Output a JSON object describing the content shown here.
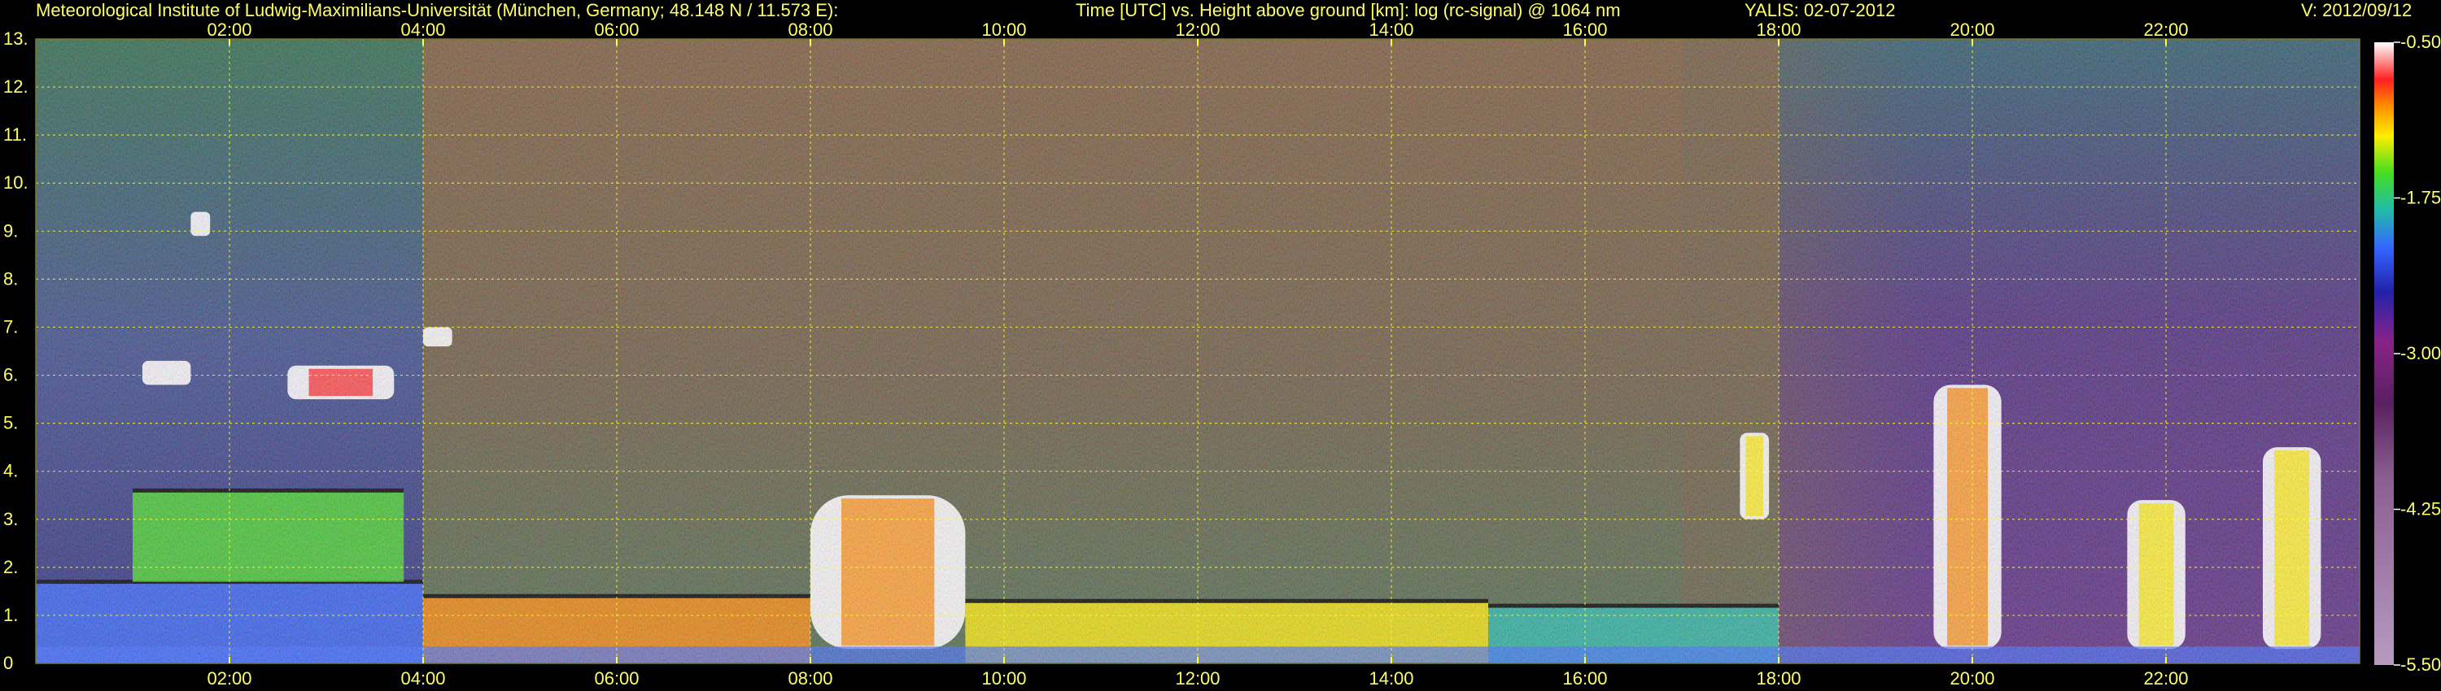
{
  "header": {
    "institute": "Meteorological Institute of Ludwig-Maximilians-Universität (München, Germany; 48.148 N / 11.573 E):",
    "description": "Time [UTC] vs. Height above ground [km]: log (rc-signal) @ 1064 nm",
    "instrument_date": "YALIS: 02-07-2012",
    "version": "V: 2012/09/12"
  },
  "colors": {
    "text": "#ffff66",
    "grid": "#ffff33",
    "background": "#000000"
  },
  "chart_data": {
    "type": "heatmap",
    "title": "Time [UTC] vs. Height above ground [km]: log (rc-signal) @ 1064 nm",
    "x_ticks": [
      "02:00",
      "04:00",
      "06:00",
      "08:00",
      "10:00",
      "12:00",
      "14:00",
      "16:00",
      "18:00",
      "20:00",
      "22:00"
    ],
    "x_tick_hours": [
      2,
      4,
      6,
      8,
      10,
      12,
      14,
      16,
      18,
      20,
      22
    ],
    "xlim_hours": [
      0,
      24
    ],
    "y_ticks": [
      "0",
      "1.",
      "2.",
      "3.",
      "4.",
      "5.",
      "6.",
      "7.",
      "8.",
      "9.",
      "10.",
      "11.",
      "12.",
      "13."
    ],
    "ylim_km": [
      0,
      13
    ],
    "grid": true,
    "colorbar": {
      "labels": [
        "-0.50",
        "-1.75",
        "-3.00",
        "-4.25",
        "-5.50"
      ],
      "values": [
        -0.5,
        -1.75,
        -3.0,
        -4.25,
        -5.5
      ],
      "range": [
        -5.5,
        -0.5
      ],
      "stops": [
        {
          "value": -0.5,
          "color": "#ffffff"
        },
        {
          "value": -0.8,
          "color": "#ff2020"
        },
        {
          "value": -1.0,
          "color": "#ff8800"
        },
        {
          "value": -1.25,
          "color": "#ffee00"
        },
        {
          "value": -1.55,
          "color": "#44dd22"
        },
        {
          "value": -1.85,
          "color": "#22bbaa"
        },
        {
          "value": -2.15,
          "color": "#3366ff"
        },
        {
          "value": -2.5,
          "color": "#2222aa"
        },
        {
          "value": -2.9,
          "color": "#882288"
        },
        {
          "value": -3.4,
          "color": "#5a2060"
        },
        {
          "value": -4.0,
          "color": "#8a5f90"
        },
        {
          "value": -5.5,
          "color": "#b89ac0"
        }
      ]
    },
    "features": [
      {
        "kind": "boundary layer aerosol",
        "t_start": 0.0,
        "t_end": 4.0,
        "h_bottom": 0.0,
        "h_top": 1.7,
        "log_signal": -2.2
      },
      {
        "kind": "residual layer",
        "t_start": 1.0,
        "t_end": 3.8,
        "h_bottom": 1.7,
        "h_top": 3.6,
        "log_signal": -1.6
      },
      {
        "kind": "cloud",
        "t_start": 1.1,
        "t_end": 1.6,
        "h_bottom": 5.8,
        "h_top": 6.3,
        "log_signal": -0.5
      },
      {
        "kind": "cloud",
        "t_start": 2.6,
        "t_end": 3.7,
        "h_bottom": 5.5,
        "h_top": 6.2,
        "log_signal": -0.5
      },
      {
        "kind": "cloud",
        "t_start": 1.6,
        "t_end": 1.8,
        "h_bottom": 8.9,
        "h_top": 9.4,
        "log_signal": -0.8
      },
      {
        "kind": "cloud",
        "t_start": 4.0,
        "t_end": 4.3,
        "h_bottom": 6.6,
        "h_top": 7.0,
        "log_signal": -0.8
      },
      {
        "kind": "boundary layer",
        "t_start": 4.0,
        "t_end": 8.0,
        "h_bottom": 0.0,
        "h_top": 1.4,
        "log_signal": -1.2
      },
      {
        "kind": "cloud",
        "t_start": 8.0,
        "t_end": 9.6,
        "h_bottom": 0.3,
        "h_top": 3.5,
        "log_signal": -0.7
      },
      {
        "kind": "boundary layer",
        "t_start": 9.6,
        "t_end": 15.0,
        "h_bottom": 0.0,
        "h_top": 1.3,
        "log_signal": -1.5
      },
      {
        "kind": "boundary layer",
        "t_start": 15.0,
        "t_end": 18.0,
        "h_bottom": 0.0,
        "h_top": 1.2,
        "log_signal": -2.0
      },
      {
        "kind": "cloud",
        "t_start": 17.6,
        "t_end": 17.9,
        "h_bottom": 3.0,
        "h_top": 4.8,
        "log_signal": -0.8
      },
      {
        "kind": "cloud",
        "t_start": 19.6,
        "t_end": 20.3,
        "h_bottom": 0.3,
        "h_top": 5.8,
        "log_signal": -0.7
      },
      {
        "kind": "cloud",
        "t_start": 21.6,
        "t_end": 22.2,
        "h_bottom": 0.3,
        "h_top": 3.4,
        "log_signal": -0.8
      },
      {
        "kind": "cloud",
        "t_start": 23.0,
        "t_end": 23.6,
        "h_bottom": 0.3,
        "h_top": 4.5,
        "log_signal": -0.8
      }
    ]
  }
}
